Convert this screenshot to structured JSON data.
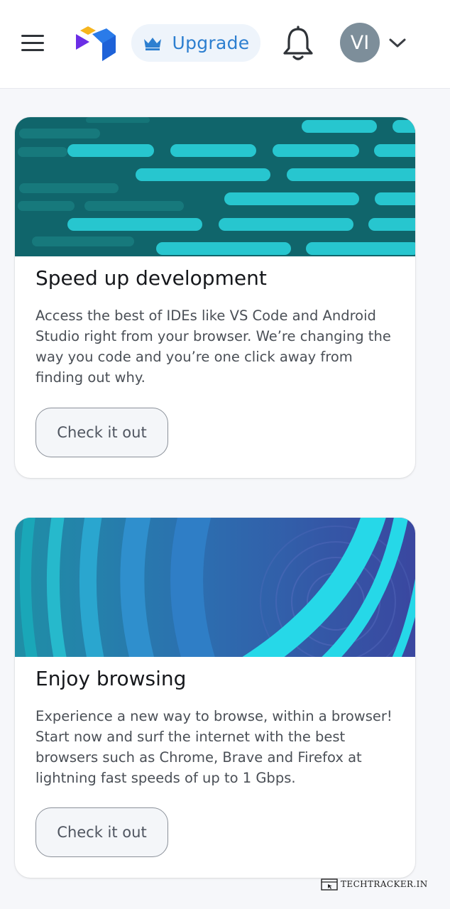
{
  "header": {
    "upgrade_label": "Upgrade",
    "avatar_initials": "VI",
    "icons": [
      "menu-icon",
      "logo-icon",
      "crown-icon",
      "bell-icon",
      "chevron-down-icon"
    ]
  },
  "cards": [
    {
      "title": "Speed up development",
      "body": "Access the best of IDEs like VS Code and Android Studio right from your browser. We’re changing the way you code and you’re one click away from finding out why.",
      "cta": "Check it out"
    },
    {
      "title": "Enjoy browsing",
      "body": "Experience a new way to browse, within a browser! Start now and surf the internet with the best browsers such as Chrome, Brave and Firefox at lightning fast speeds of up to 1 Gbps.",
      "cta": "Check it out"
    }
  ],
  "watermark": "TECHTRACKER.IN",
  "colors": {
    "accent": "#2d7fd0",
    "upgrade_bg": "#eef4fb",
    "avatar_bg": "#7d8e9a",
    "banner1_bg": "#126a6c",
    "banner1_stripes": "#27c6cf",
    "banner2_bg": "#3a50a6",
    "banner2_arcs": "#26d8e8"
  }
}
